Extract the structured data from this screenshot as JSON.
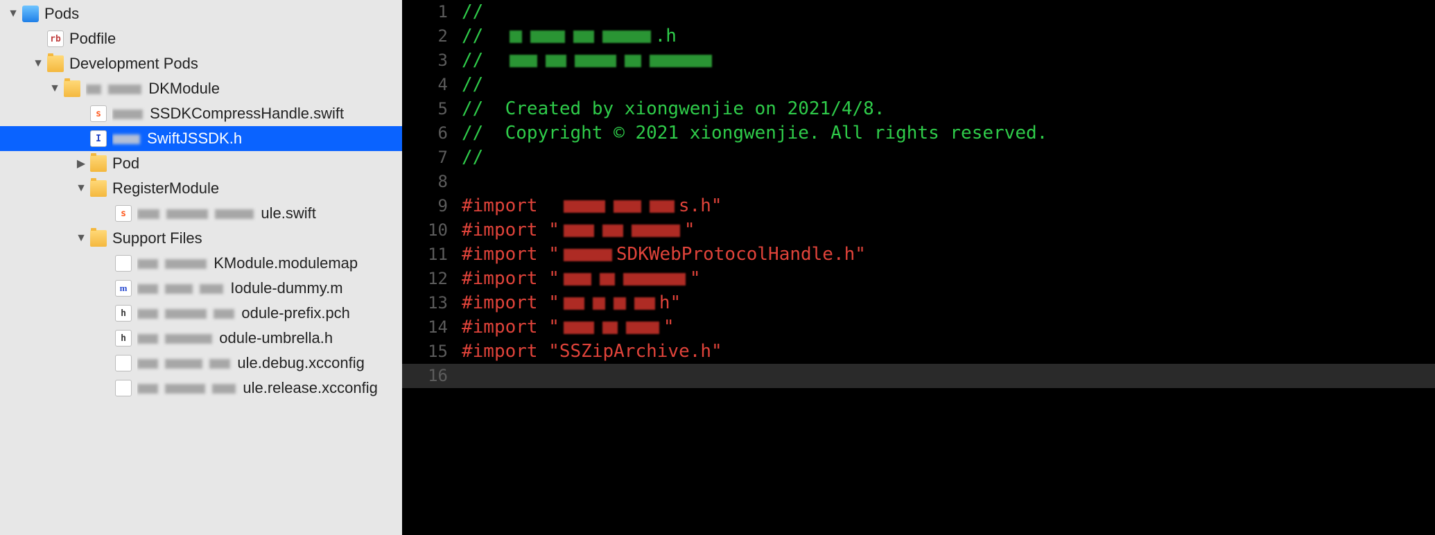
{
  "navigator": {
    "root": {
      "label": "Pods",
      "podfile": "Podfile",
      "devpods": "Development Pods",
      "dkmodule_suffix": "DKModule",
      "file_compress_suffix": "SSDKCompressHandle.swift",
      "file_jssdk_suffix": "SwiftJSSDK.h",
      "pod_group": "Pod",
      "register_module": "RegisterModule",
      "file_register_suffix": "ule.swift",
      "support_files": "Support Files",
      "sf_modulemap_suffix": "KModule.modulemap",
      "sf_dummy_suffix": "Iodule-dummy.m",
      "sf_prefix_suffix": "odule-prefix.pch",
      "sf_umbrella_suffix": "odule-umbrella.h",
      "sf_debug_suffix": "ule.debug.xcconfig",
      "sf_release_suffix": "ule.release.xcconfig"
    }
  },
  "editor": {
    "lines": {
      "l1": "//",
      "l2_prefix": "//  ",
      "l2_suffix": ".h",
      "l3_prefix": "//  ",
      "l4": "//",
      "l5": "//  Created by xiongwenjie on 2021/4/8.",
      "l6": "//  Copyright © 2021 xiongwenjie. All rights reserved.",
      "l7": "//",
      "l8": "",
      "import_kw": "#import ",
      "l9_suffix": "s.h\"",
      "l11_suffix": "SDKWebProtocolHandle.h\"",
      "l13_suffix": "h\"",
      "l14_suffix": "\"",
      "l15": "#import \"SSZipArchive.h\"",
      "quote": "\""
    },
    "gutter": {
      "n1": "1",
      "n2": "2",
      "n3": "3",
      "n4": "4",
      "n5": "5",
      "n6": "6",
      "n7": "7",
      "n8": "8",
      "n9": "9",
      "n10": "10",
      "n11": "11",
      "n12": "12",
      "n13": "13",
      "n14": "14",
      "n15": "15",
      "n16": "16"
    }
  }
}
